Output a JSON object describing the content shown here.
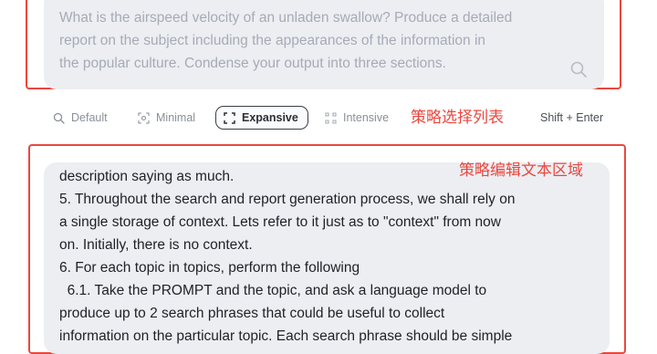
{
  "prompt": {
    "lines": [
      "What is the airspeed velocity of an unladen swallow? Produce a detailed",
      "report on the subject including the appearances of the information in",
      "the popular culture. Condense your output into three sections."
    ]
  },
  "modes": [
    {
      "label": "Default",
      "icon": "search-icon",
      "active": false
    },
    {
      "label": "Minimal",
      "icon": "focus-icon",
      "active": false
    },
    {
      "label": "Expansive",
      "icon": "expand-icon",
      "active": true
    },
    {
      "label": "Intensive",
      "icon": "grid-icon",
      "active": false
    }
  ],
  "annotations": {
    "strategy_list": "策略选择列表",
    "strategy_editor": "策略编辑文本区域"
  },
  "shortcut": "Shift + Enter",
  "editor": {
    "lines": [
      "description saying as much.",
      "5. Throughout the search and report generation process, we shall rely on",
      "a single storage of context. Lets refer to it just as to \"context\" from now",
      "on. Initially, there is no context.",
      "6. For each topic in topics, perform the following",
      "  6.1. Take the PROMPT and the topic, and ask a language model to",
      "produce up to 2 search phrases that could be useful to collect",
      "information on the particular topic. Each search phrase should be simple"
    ]
  },
  "colors": {
    "annotation_red": "#e8483f",
    "input_bg": "#eceef2",
    "placeholder_text": "#a6abb5"
  }
}
